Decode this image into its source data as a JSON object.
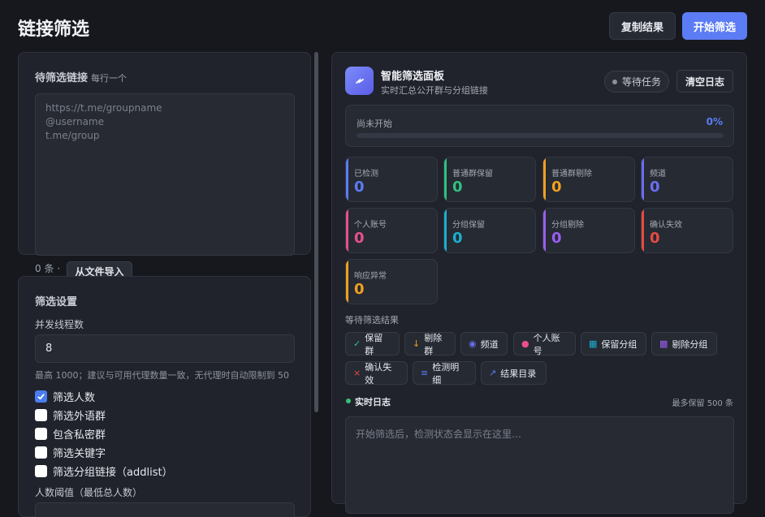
{
  "header": {
    "title": "链接筛选",
    "copy_label": "复制结果",
    "start_label": "开始筛选"
  },
  "input": {
    "heading": "待筛选链接",
    "subheading": "每行一个",
    "placeholder": "https://t.me/groupname\n@username\nt.me/group",
    "count_text": "0 条 ·",
    "import_label": "从文件导入"
  },
  "settings": {
    "title": "筛选设置",
    "threads_label": "并发线程数",
    "threads_value": "8",
    "threads_hint": "最高 1000；建议与可用代理数量一致，无代理时自动限制到 50",
    "options": [
      {
        "label": "筛选人数",
        "checked": true
      },
      {
        "label": "筛选外语群",
        "checked": false
      },
      {
        "label": "包含私密群",
        "checked": false
      },
      {
        "label": "筛选关键字",
        "checked": false
      },
      {
        "label": "筛选分组链接（addlist）",
        "checked": false
      }
    ],
    "threshold_label": "人数阈值（最低总人数）"
  },
  "panel": {
    "title": "智能筛选面板",
    "subtitle": "实时汇总公开群与分组链接",
    "status": "等待任务",
    "clear_label": "清空日志",
    "progress_label": "尚未开始",
    "progress_pct_text": "0%",
    "progress_value": 0
  },
  "stats": [
    {
      "label": "已检测",
      "value": "0",
      "color": "#5b7cf4"
    },
    {
      "label": "普通群保留",
      "value": "0",
      "color": "#2ec27e"
    },
    {
      "label": "普通群剔除",
      "value": "0",
      "color": "#f0a020"
    },
    {
      "label": "频道",
      "value": "0",
      "color": "#6a6ef0"
    },
    {
      "label": "个人账号",
      "value": "0",
      "color": "#e8508a"
    },
    {
      "label": "分组保留",
      "value": "0",
      "color": "#1ab0d0"
    },
    {
      "label": "分组剔除",
      "value": "0",
      "color": "#9a5ef0"
    },
    {
      "label": "确认失效",
      "value": "0",
      "color": "#e84a40"
    },
    {
      "label": "响应异常",
      "value": "0",
      "color": "#f0a020"
    }
  ],
  "results": {
    "label": "等待筛选结果",
    "chips": [
      {
        "label": "保留群",
        "icon": "✓",
        "icon_color": "#2ec27e",
        "icon_name": "check-icon"
      },
      {
        "label": "剔除群",
        "icon": "↓",
        "icon_color": "#f0a020",
        "icon_name": "arrow-down-icon"
      },
      {
        "label": "频道",
        "icon": "◉",
        "icon_color": "#6a6ef0",
        "icon_name": "channel-icon"
      },
      {
        "label": "个人账号",
        "icon": "●",
        "icon_color": "#e8508a",
        "icon_name": "person-dot-icon"
      },
      {
        "label": "保留分组",
        "icon": "▦",
        "icon_color": "#1ab0d0",
        "icon_name": "grid-icon"
      },
      {
        "label": "剔除分组",
        "icon": "▩",
        "icon_color": "#9a5ef0",
        "icon_name": "grid-remove-icon"
      },
      {
        "label": "确认失效",
        "icon": "×",
        "icon_color": "#e84a40",
        "icon_name": "close-icon"
      },
      {
        "label": "检测明细",
        "icon": "≡",
        "icon_color": "#5b7cf4",
        "icon_name": "list-icon"
      },
      {
        "label": "结果目录",
        "icon": "↗",
        "icon_color": "#5b7cf4",
        "icon_name": "external-link-icon"
      }
    ]
  },
  "log": {
    "title": "实时日志",
    "keep_text": "最多保留 500 条",
    "placeholder": "开始筛选后，检测状态会显示在这里…"
  }
}
